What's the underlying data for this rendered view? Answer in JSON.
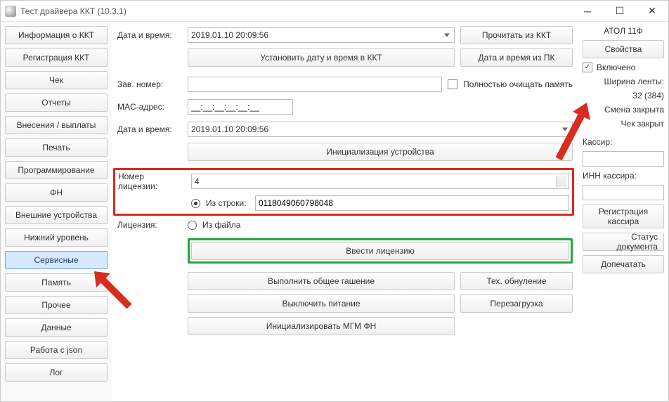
{
  "window": {
    "title": "Тест драйвера ККТ (10.3.1)"
  },
  "sidebar": {
    "items": [
      {
        "label": "Информация о ККТ"
      },
      {
        "label": "Регистрация ККТ"
      },
      {
        "label": "Чек"
      },
      {
        "label": "Отчеты"
      },
      {
        "label": "Внесения / выплаты"
      },
      {
        "label": "Печать"
      },
      {
        "label": "Программирование"
      },
      {
        "label": "ФН"
      },
      {
        "label": "Внешние устройства"
      },
      {
        "label": "Нижний уровень"
      },
      {
        "label": "Сервисные",
        "selected": true
      },
      {
        "label": "Память"
      },
      {
        "label": "Прочее"
      },
      {
        "label": "Данные"
      },
      {
        "label": "Работа с json"
      },
      {
        "label": "Лог"
      }
    ]
  },
  "center": {
    "datetime_label": "Дата и время:",
    "datetime_value": "2019.01.10 20:09:56",
    "read_from_kkt": "Прочитать из ККТ",
    "set_datetime_kkt": "Установить дату и время в ККТ",
    "datetime_from_pc": "Дата и время из ПК",
    "serial_label": "Зав. номер:",
    "serial_value": "",
    "fullclear_label": "Полностью очищать память",
    "mac_label": "MAC-адрес:",
    "mac_value": "__:__:__:__:__:__",
    "datetime2_value": "2019.01.10 20:09:56",
    "init_device": "Инициализация устройства",
    "license_no_label": "Номер лицензии:",
    "license_no_value": "4",
    "license_label": "Лицензия:",
    "from_string_label": "Из строки:",
    "from_string_value": "0118049060798048",
    "from_file_label": "Из файла",
    "enter_license": "Ввести лицензию",
    "full_clear_btn": "Выполнить общее гашение",
    "tech_reset": "Тех. обнуление",
    "power_off": "Выключить питание",
    "reboot": "Перезагрузка",
    "init_mgm": "Инициализировать МГМ ФН"
  },
  "right": {
    "device_name": "АТОЛ 11Ф",
    "properties": "Свойства",
    "enabled_label": "Включено",
    "tape_width_label": "Ширина ленты:",
    "tape_width_value": "32 (384)",
    "shift_status": "Смена закрыта",
    "check_status": "Чек закрыт",
    "cashier_label": "Кассир:",
    "cashier_value": "",
    "cashier_inn_label": "ИНН кассира:",
    "cashier_inn_value": "",
    "register_cashier": "Регистрация кассира",
    "doc_status": "Статус документа",
    "print_more": "Допечатать"
  }
}
